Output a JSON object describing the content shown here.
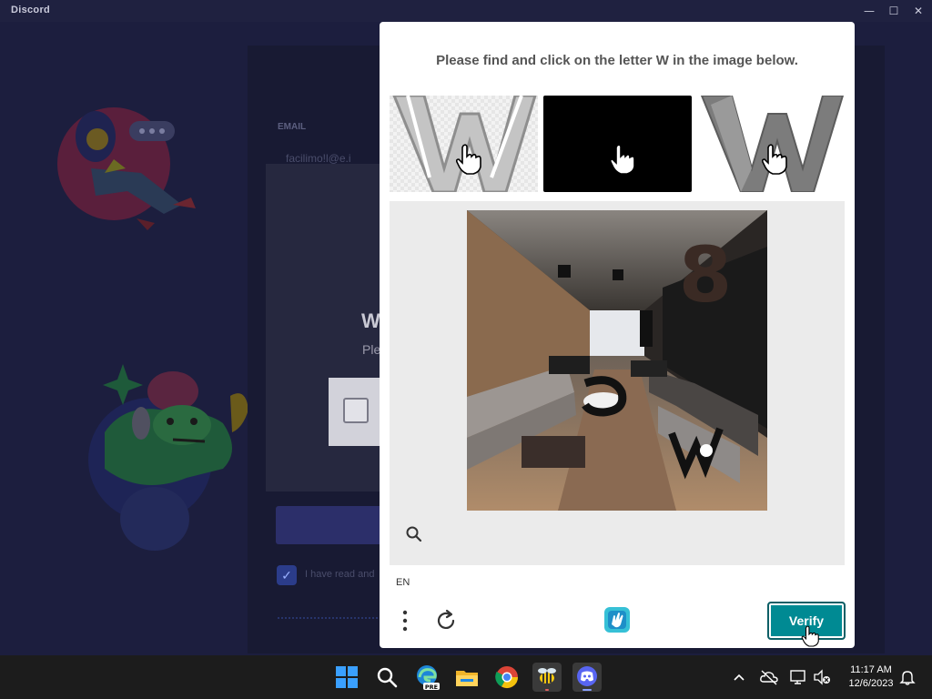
{
  "window": {
    "app_title": "Discord",
    "controls": {
      "minimize": "—",
      "maximize": "☐",
      "close": "✕"
    }
  },
  "background_app": {
    "email_label": "EMAIL",
    "email_value": "facilimo!l@e.i",
    "modal_title_fragment": "W",
    "modal_subtitle_fragment": "Ple",
    "tos_text_fragment": "I have read and"
  },
  "captcha": {
    "prompt": "Please find and click on the letter W in the image below.",
    "examples": [
      {
        "name": "example-w-light",
        "letter": "W",
        "color": "#b9b9b9"
      },
      {
        "name": "example-black",
        "color": "#000000"
      },
      {
        "name": "example-w-dark",
        "letter": "W",
        "color": "#7c7c7c"
      }
    ],
    "main_image": {
      "description_icons": [
        "8",
        "5",
        "W"
      ]
    },
    "language": "EN",
    "verify_label": "Verify",
    "colors": {
      "accent": "#008a93",
      "panel": "#ebebeb"
    }
  },
  "taskbar": {
    "icons": [
      "windows-start-icon",
      "search-icon",
      "edge-pre-icon",
      "file-explorer-icon",
      "chrome-icon",
      "bee-app-icon",
      "discord-icon"
    ],
    "time": "11:17 AM",
    "date": "12/6/2023"
  }
}
